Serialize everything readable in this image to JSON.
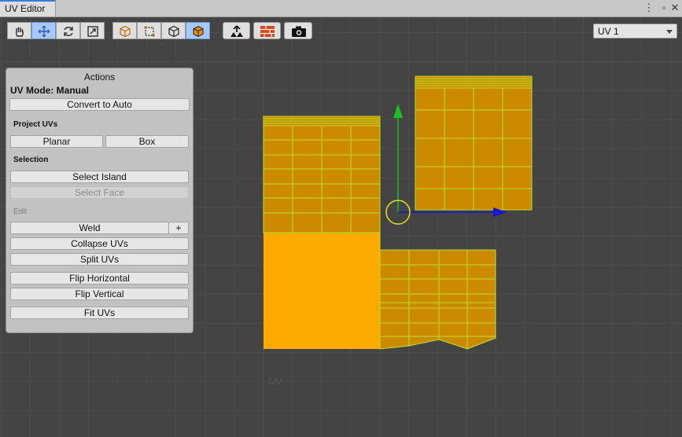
{
  "window": {
    "tab_title": "UV Editor",
    "menu_icon": "kebab-menu-icon",
    "close_icon": "close-icon"
  },
  "toolbar": {
    "tools": [
      {
        "icon": "hand-icon",
        "active": false
      },
      {
        "icon": "move-icon",
        "active": true
      },
      {
        "icon": "rotate-icon",
        "active": false
      },
      {
        "icon": "scale-icon",
        "active": false
      }
    ],
    "select_modes": [
      {
        "icon": "vertex-mode-icon",
        "active": false
      },
      {
        "icon": "edge-mode-icon",
        "active": false
      },
      {
        "icon": "face-mode-icon",
        "active": false
      },
      {
        "icon": "object-mode-icon",
        "active": true
      }
    ],
    "extra": [
      "export-uv-icon",
      "texture-grid-icon",
      "camera-icon"
    ]
  },
  "uv_channel": {
    "selected": "UV 1"
  },
  "actions_panel": {
    "title": "Actions",
    "mode": "UV Mode: Manual",
    "convert_label": "Convert to Auto",
    "project_header": "Project UVs",
    "planar_label": "Planar",
    "box_label": "Box",
    "selection_header": "Selection",
    "select_island_label": "Select Island",
    "select_face_label": "Select Face",
    "edit_header": "Edit",
    "weld_label": "Weld",
    "weld_plus": "+",
    "collapse_label": "Collapse UVs",
    "split_label": "Split UVs",
    "flip_h_label": "Flip Horizontal",
    "flip_v_label": "Flip Vertical",
    "fit_label": "Fit UVs"
  },
  "watermark": "UV",
  "colors": {
    "uv_fill": "#cc8a00",
    "uv_fill_bright": "#ffaa00",
    "uv_wire": "#b7e028",
    "axis_y": "#1fbf1f",
    "axis_x": "#1a1acc",
    "pivot": "#e6e020"
  }
}
